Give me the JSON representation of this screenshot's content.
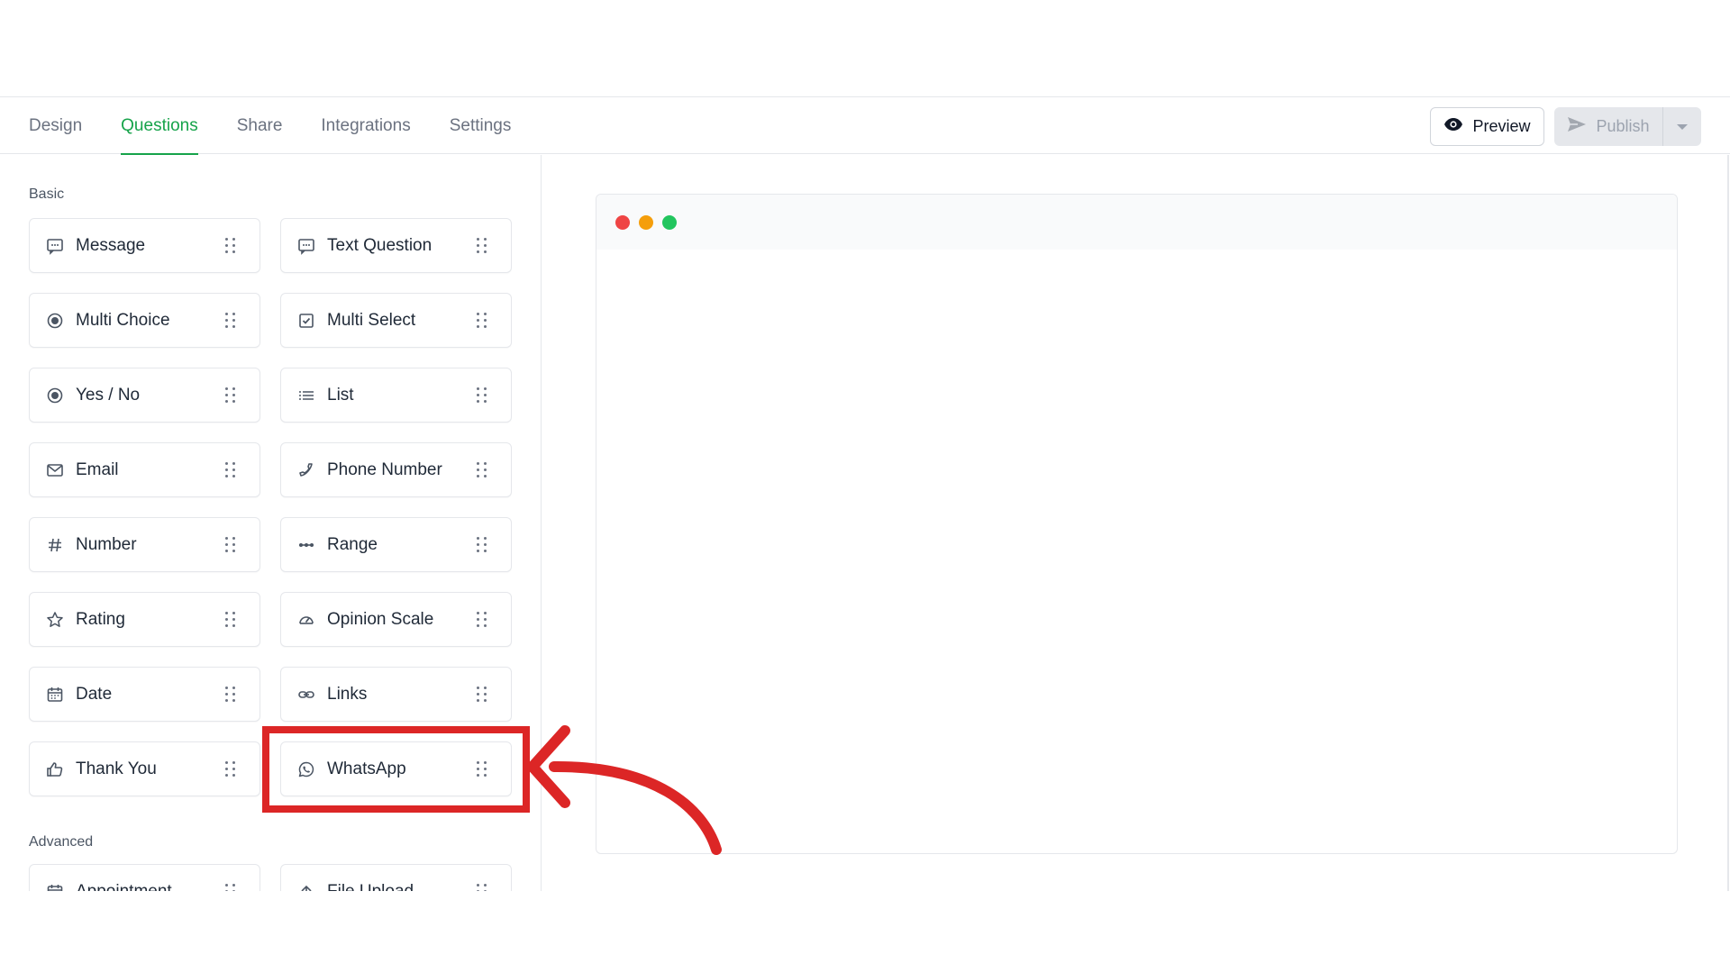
{
  "tabs": [
    {
      "label": "Design",
      "active": false
    },
    {
      "label": "Questions",
      "active": true
    },
    {
      "label": "Share",
      "active": false
    },
    {
      "label": "Integrations",
      "active": false
    },
    {
      "label": "Settings",
      "active": false
    }
  ],
  "actions": {
    "preview_label": "Preview",
    "publish_label": "Publish"
  },
  "sidebar": {
    "basic_title": "Basic",
    "advanced_title": "Advanced",
    "basic_items": [
      {
        "label": "Message",
        "icon": "message-icon"
      },
      {
        "label": "Text Question",
        "icon": "text-question-icon"
      },
      {
        "label": "Multi Choice",
        "icon": "radio-icon"
      },
      {
        "label": "Multi Select",
        "icon": "checkbox-icon"
      },
      {
        "label": "Yes / No",
        "icon": "radio-icon"
      },
      {
        "label": "List",
        "icon": "list-icon"
      },
      {
        "label": "Email",
        "icon": "mail-icon"
      },
      {
        "label": "Phone Number",
        "icon": "phone-icon"
      },
      {
        "label": "Number",
        "icon": "hash-icon"
      },
      {
        "label": "Range",
        "icon": "range-icon"
      },
      {
        "label": "Rating",
        "icon": "star-icon"
      },
      {
        "label": "Opinion Scale",
        "icon": "gauge-icon"
      },
      {
        "label": "Date",
        "icon": "calendar-icon"
      },
      {
        "label": "Links",
        "icon": "link-icon"
      },
      {
        "label": "Thank You",
        "icon": "thumbs-up-icon"
      },
      {
        "label": "WhatsApp",
        "icon": "whatsapp-icon"
      }
    ],
    "advanced_items": [
      {
        "label": "Appointment",
        "icon": "calendar-icon"
      },
      {
        "label": "File Upload",
        "icon": "upload-icon"
      }
    ]
  },
  "colors": {
    "accent": "#16a34a",
    "annotation": "#dc2626",
    "dot_red": "#ef4444",
    "dot_yellow": "#f59e0b",
    "dot_green": "#22c55e"
  }
}
